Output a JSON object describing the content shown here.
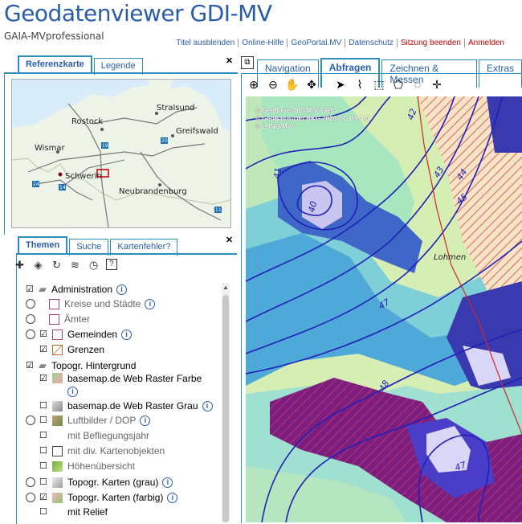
{
  "header": {
    "title": "Geodatenviewer GDI-MV",
    "subtitle": "GAIA-MVprofessional",
    "links": [
      {
        "label": "Titel ausblenden",
        "color": "blue"
      },
      {
        "label": "Online-Hilfe",
        "color": "blue"
      },
      {
        "label": "GeoPortal.MV",
        "color": "blue"
      },
      {
        "label": "Datenschutz",
        "color": "blue"
      },
      {
        "label": "Sitzung beenden",
        "color": "red"
      },
      {
        "label": "Anmelden",
        "color": "red"
      }
    ]
  },
  "refpanel": {
    "tabs": [
      "Referenzkarte",
      "Legende"
    ],
    "cities": [
      "Stralsund",
      "Rostock",
      "Greifswald",
      "Wismar",
      "Schwerin",
      "Neubrandenburg"
    ],
    "roads": [
      "19",
      "20",
      "24",
      "14",
      "11"
    ]
  },
  "layerpanel": {
    "tabs": [
      "Themen",
      "Suche",
      "Kartenfehler?"
    ],
    "items": [
      {
        "label": "Administration",
        "info": true
      },
      {
        "label": "Kreise und Städte",
        "info": true
      },
      {
        "label": "Ämter",
        "info": false
      },
      {
        "label": "Gemeinden",
        "info": true
      },
      {
        "label": "Grenzen",
        "info": false
      },
      {
        "label": "Topogr. Hintergrund",
        "info": false
      },
      {
        "label": "basemap.de Web Raster Farbe",
        "info": true
      },
      {
        "label": "basemap.de Web Raster Grau",
        "info": true
      },
      {
        "label": "Luftbilder / DOP",
        "info": true
      },
      {
        "label": "mit Befliegungsjahr",
        "info": false
      },
      {
        "label": "mit div. Kartenobjekten",
        "info": false
      },
      {
        "label": "Höhenübersicht",
        "info": false
      },
      {
        "label": "Topogr. Karten (grau)",
        "info": true
      },
      {
        "label": "Topogr. Karten (farbig)",
        "info": true
      },
      {
        "label": "mit Relief",
        "info": false
      }
    ]
  },
  "mappanel": {
    "tabs": [
      "Navigation",
      "Abfragen",
      "Zeichnen & Messen",
      "Extras"
    ],
    "active_tab": "Abfragen",
    "copyright": [
      "© GeoBasis-DE/ M-V 2026",
      "© GeoBasis-DE/ BKG 2026 CC BY 4.0",
      "© LUNG M-V"
    ],
    "contour_labels": [
      "41",
      "42",
      "40",
      "43",
      "44",
      "45",
      "47",
      "48",
      "47"
    ],
    "place": "Lohmen"
  },
  "info_symbol": "i"
}
